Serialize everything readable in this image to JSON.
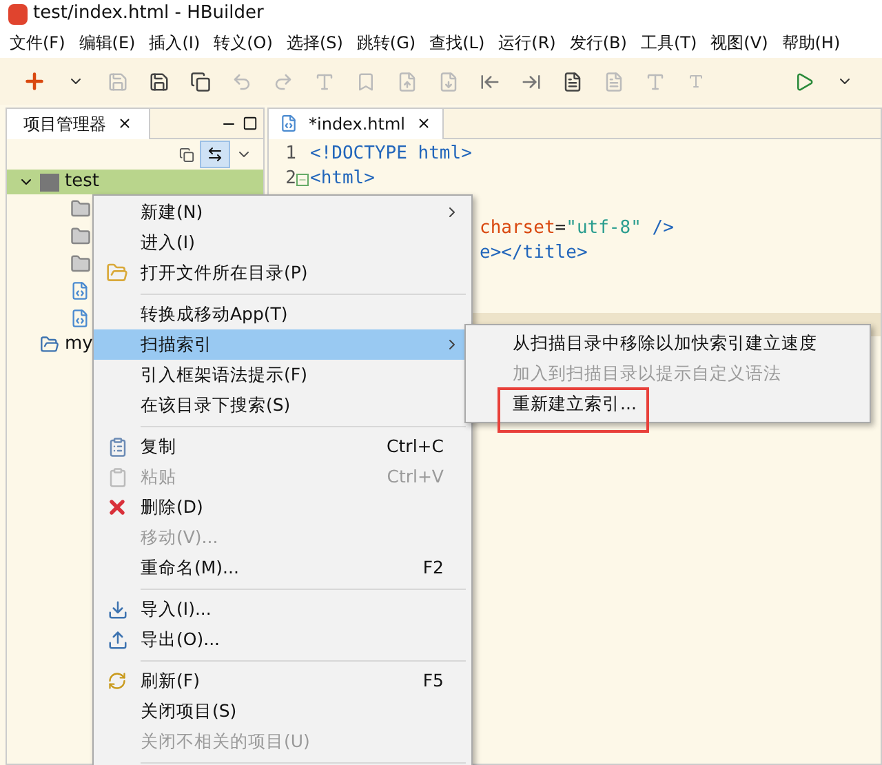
{
  "window": {
    "title": "test/index.html  -  HBuilder"
  },
  "menubar": [
    "文件(F)",
    "编辑(E)",
    "插入(I)",
    "转义(O)",
    "选择(S)",
    "跳转(G)",
    "查找(L)",
    "运行(R)",
    "发行(B)",
    "工具(T)",
    "视图(V)",
    "帮助(H)"
  ],
  "project_panel": {
    "tab": {
      "label": "项目管理器",
      "selected": true
    },
    "tree": [
      {
        "label": "test",
        "kind": "web-project",
        "expanded": true,
        "selected": true,
        "children": [
          {
            "kind": "folder"
          },
          {
            "kind": "folder"
          },
          {
            "kind": "folder"
          },
          {
            "kind": "file"
          },
          {
            "kind": "file"
          }
        ]
      },
      {
        "label": "my",
        "kind": "project",
        "selected": false
      }
    ]
  },
  "editor": {
    "tab": {
      "label": "*index.html",
      "selected": true
    },
    "lines": [
      {
        "number": "1",
        "tokens": [
          {
            "kind": "tag",
            "text": "<!DOCTYPE html>"
          }
        ]
      },
      {
        "number": "2",
        "foldable": true,
        "tokens": [
          {
            "kind": "tag",
            "text": "<html>"
          }
        ]
      },
      {
        "tokens": [
          {
            "kind": "attr",
            "text": "charset"
          },
          {
            "kind": "plain",
            "text": "="
          },
          {
            "kind": "string",
            "text": "\"utf-8\""
          },
          {
            "kind": "tag",
            "text": " />"
          }
        ]
      },
      {
        "tokens": [
          {
            "kind": "tag",
            "text": "e></title>"
          }
        ]
      }
    ]
  },
  "context_menu": [
    {
      "kind": "item",
      "label": "新建(N)",
      "submenu": true,
      "disabled": false,
      "selected": false
    },
    {
      "kind": "item",
      "label": "进入(I)",
      "disabled": false,
      "selected": false
    },
    {
      "kind": "item",
      "label": "打开文件所在目录(P)",
      "disabled": false,
      "selected": false
    },
    {
      "kind": "separator"
    },
    {
      "kind": "item",
      "label": "转换成移动App(T)",
      "disabled": false,
      "selected": false
    },
    {
      "kind": "item",
      "label": "扫描索引",
      "submenu": true,
      "disabled": false,
      "selected": true
    },
    {
      "kind": "item",
      "label": "引入框架语法提示(F)",
      "disabled": false,
      "selected": false
    },
    {
      "kind": "item",
      "label": "在该目录下搜索(S)",
      "disabled": false,
      "selected": false
    },
    {
      "kind": "separator"
    },
    {
      "kind": "item",
      "label": "复制",
      "shortcut": "Ctrl+C",
      "disabled": false,
      "selected": false
    },
    {
      "kind": "item",
      "label": "粘贴",
      "shortcut": "Ctrl+V",
      "disabled": true,
      "selected": false
    },
    {
      "kind": "item",
      "label": "删除(D)",
      "disabled": false,
      "selected": false
    },
    {
      "kind": "item",
      "label": "移动(V)...",
      "disabled": true,
      "selected": false
    },
    {
      "kind": "item",
      "label": "重命名(M)...",
      "shortcut": "F2",
      "disabled": false,
      "selected": false
    },
    {
      "kind": "separator"
    },
    {
      "kind": "item",
      "label": "导入(I)...",
      "disabled": false,
      "selected": false
    },
    {
      "kind": "item",
      "label": "导出(O)...",
      "disabled": false,
      "selected": false
    },
    {
      "kind": "separator"
    },
    {
      "kind": "item",
      "label": "刷新(F)",
      "shortcut": "F5",
      "disabled": false,
      "selected": false
    },
    {
      "kind": "item",
      "label": "关闭项目(S)",
      "disabled": false,
      "selected": false
    },
    {
      "kind": "item",
      "label": "关闭不相关的项目(U)",
      "disabled": true,
      "selected": false
    },
    {
      "kind": "separator"
    }
  ],
  "submenu": [
    {
      "label": "从扫描目录中移除以加快索引建立速度",
      "disabled": false,
      "highlighted": false
    },
    {
      "label": "加入到扫描目录以提示自定义语法",
      "disabled": true,
      "highlighted": false
    },
    {
      "label": "重新建立索引...",
      "disabled": false,
      "highlighted": true
    }
  ]
}
